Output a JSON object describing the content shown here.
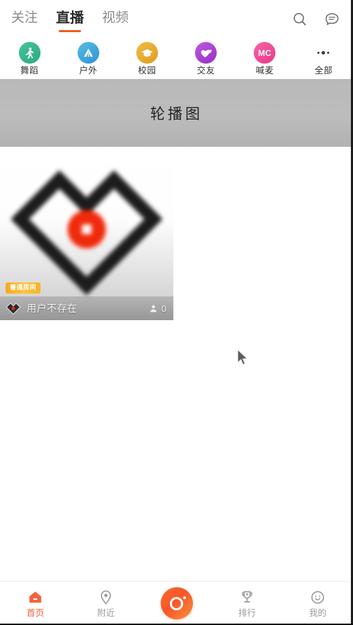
{
  "top_nav": {
    "tabs": [
      {
        "label": "关注",
        "active": false
      },
      {
        "label": "直播",
        "active": true
      },
      {
        "label": "视频",
        "active": false
      }
    ],
    "search_icon": "search-icon",
    "message_icon": "message-bubble-icon"
  },
  "categories": [
    {
      "label": "舞蹈",
      "icon": "dance-icon",
      "color": "#3fb58a"
    },
    {
      "label": "户外",
      "icon": "tent-outdoor-icon",
      "color": "#3ba6dd"
    },
    {
      "label": "校园",
      "icon": "graduation-cap-icon",
      "color": "#e8a82c"
    },
    {
      "label": "交友",
      "icon": "two-hearts-icon",
      "color": "#a83fd4"
    },
    {
      "label": "喊麦",
      "icon": "mc-icon",
      "color": "#ef4f96",
      "text": "MC"
    },
    {
      "label": "全部",
      "icon": "ellipsis-icon",
      "color": "#3c3c3c"
    }
  ],
  "carousel": {
    "placeholder_text": "轮播图"
  },
  "live_cards": [
    {
      "badge": "普通房间",
      "title": "用户不存在",
      "viewers": "0",
      "viewer_icon": "person-icon",
      "room_icon": "heart-diamond-logo-icon",
      "thumbnail": "blurred-heart-diamond-logo"
    }
  ],
  "bottom_nav": {
    "items": [
      {
        "label": "首页",
        "icon": "home-icon",
        "active": true
      },
      {
        "label": "附近",
        "icon": "location-pin-icon",
        "active": false
      },
      {
        "label": "",
        "icon": "camera-live-button",
        "active": false,
        "center": true
      },
      {
        "label": "排行",
        "icon": "trophy-icon",
        "active": false
      },
      {
        "label": "我的",
        "icon": "smiley-face-icon",
        "active": false
      }
    ],
    "active_color": "#f4633a",
    "inactive_color": "#9a9a9a"
  },
  "cursor": {
    "x": "343",
    "y": "510"
  },
  "theme": {
    "accent": "#ef5b26",
    "background": "#ffffff",
    "carousel_gray": "#b9b9b9",
    "badge_orange": "#f6a821"
  }
}
